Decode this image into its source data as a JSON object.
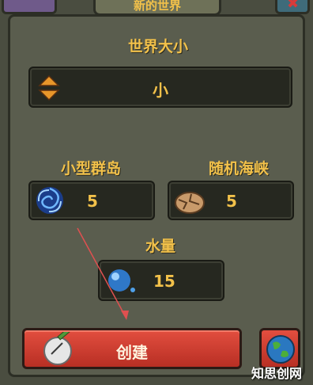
{
  "window": {
    "title": "新的世界"
  },
  "world_size": {
    "label": "世界大小",
    "value": "小"
  },
  "small_islands": {
    "label": "小型群岛",
    "value": "5"
  },
  "random_straits": {
    "label": "随机海峡",
    "value": "5"
  },
  "water": {
    "label": "水量",
    "value": "15"
  },
  "create_button": {
    "label": "创建"
  },
  "watermark": {
    "text": "知思创网"
  },
  "colors": {
    "accent": "#f2c14a",
    "button": "#d43f31",
    "panel": "#5a5d4e"
  }
}
